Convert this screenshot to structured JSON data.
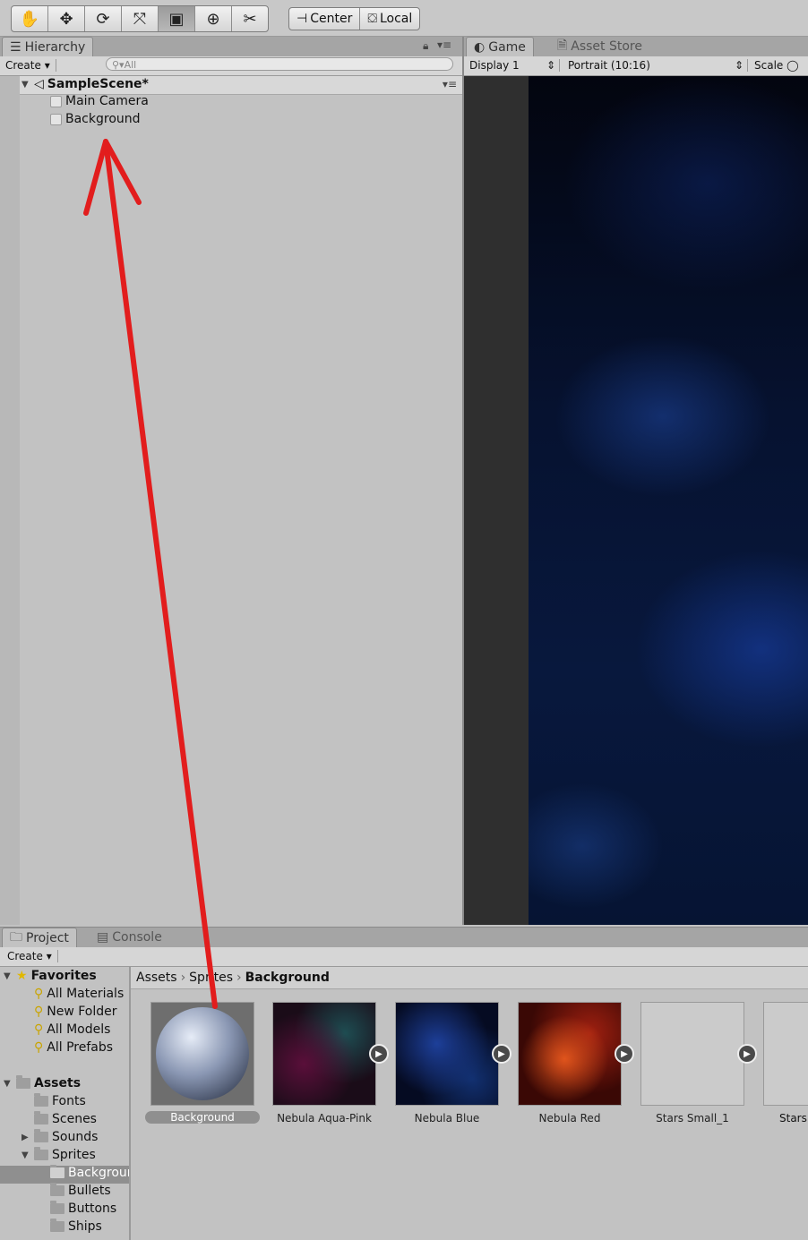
{
  "toolbar": {
    "tools": [
      "hand-tool-icon",
      "move-tool-icon",
      "rotate-tool-icon",
      "scale-tool-icon",
      "rect-tool-icon",
      "transform-tool-icon",
      "custom-tool-icon"
    ],
    "pivot_label": "Center",
    "space_label": "Local"
  },
  "hierarchy": {
    "tab_label": "Hierarchy",
    "create_label": "Create",
    "search_placeholder": "All",
    "scene_name": "SampleScene*",
    "items": [
      "Main Camera",
      "Background"
    ]
  },
  "game": {
    "tab_label": "Game",
    "asset_store_label": "Asset Store",
    "display_label": "Display 1",
    "aspect_label": "Portrait (10:16)",
    "scale_label": "Scale"
  },
  "project": {
    "tab_label": "Project",
    "console_label": "Console",
    "create_label": "Create",
    "favorites_label": "Favorites",
    "favorites": [
      "All Materials",
      "New Folder",
      "All Models",
      "All Prefabs"
    ],
    "assets_label": "Assets",
    "folders": [
      "Fonts",
      "Scenes",
      "Sounds",
      "Sprites"
    ],
    "sprite_folders": [
      "Background",
      "Bullets",
      "Buttons",
      "Ships"
    ],
    "breadcrumb": [
      "Assets",
      "Sprites",
      "Background"
    ],
    "assets": [
      "Background",
      "Nebula Aqua-Pink",
      "Nebula Blue",
      "Nebula Red",
      "Stars Small_1",
      "Stars"
    ]
  },
  "annotation": {
    "arrow_color": "#e21d1d"
  }
}
